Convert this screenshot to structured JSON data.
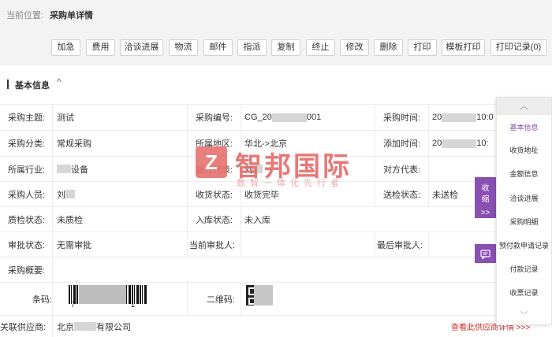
{
  "breadcrumb": {
    "label": "当前位置:",
    "current": "采购单详情"
  },
  "toolbar": [
    "加急",
    "费用",
    "洽谈进展",
    "物流",
    "邮件",
    "指派",
    "复制",
    "终止",
    "修改",
    "删除",
    "打印",
    "模板打印",
    "打印记录(0)"
  ],
  "section": {
    "title": "基本信息",
    "caret": "^"
  },
  "fields": {
    "subject_label": "采购主题:",
    "subject": "测试",
    "number_label": "采购编号:",
    "number_prefix": "CG_20",
    "number_suffix": "001",
    "time_label": "采购时间:",
    "time_prefix": "20",
    "time_suffix": "10:0",
    "category_label": "采购分类:",
    "category": "常规采购",
    "region_label": "所属地区:",
    "region": "华北->北京",
    "add_time_label": "添加时间:",
    "add_time_prefix": "20",
    "add_time_suffix": "10:",
    "industry_label": "所属行业:",
    "industry_suffix": "设备",
    "our_rep_label": "我方代表:",
    "our_rep": "刘",
    "their_rep_label": "对方代表:",
    "their_rep": "",
    "buyer_label": "采购人员:",
    "buyer": "刘",
    "receive_label": "收货状态:",
    "receive": "收货完毕",
    "inspect_label": "送检状态:",
    "inspect": "未送检",
    "quality_label": "质检状态:",
    "quality": "未质检",
    "stock_label": "入库状态:",
    "stock": "未入库",
    "approval_label": "审批状态:",
    "approval": "无需审批",
    "current_approver_label": "当前审批人:",
    "current_approver": "",
    "last_approver_label": "最后审批人:",
    "last_approver": "",
    "summary_label": "采购概要:",
    "summary": "",
    "barcode_label": "条码:",
    "barcode_prefix": "7",
    "barcode_suffix": "1",
    "qrcode_label": "二维码:",
    "supplier_label": "关联供应商:",
    "supplier_prefix": "北京",
    "supplier_suffix": "有限公司",
    "supplier_link": "查看此供应商详情 >>>"
  },
  "watermark": {
    "logo": "Z",
    "title": "智邦国际",
    "subtitle": "数智一体化先行者"
  },
  "collapse_tab": {
    "label": "收缩",
    "arrow": ">>"
  },
  "chat_icon": "chat-icon",
  "sidenav": {
    "up": "︿",
    "items": [
      "基本信息",
      "收货地址",
      "金额信息",
      "洽谈进展",
      "采购明细",
      "预付款申请记录",
      "付款记录",
      "收票记录"
    ],
    "active": "基本信息",
    "down": "﹀"
  },
  "colors": {
    "accent": "#8a4fb3",
    "link": "#d52a2a",
    "watermark": "#e46b68"
  }
}
